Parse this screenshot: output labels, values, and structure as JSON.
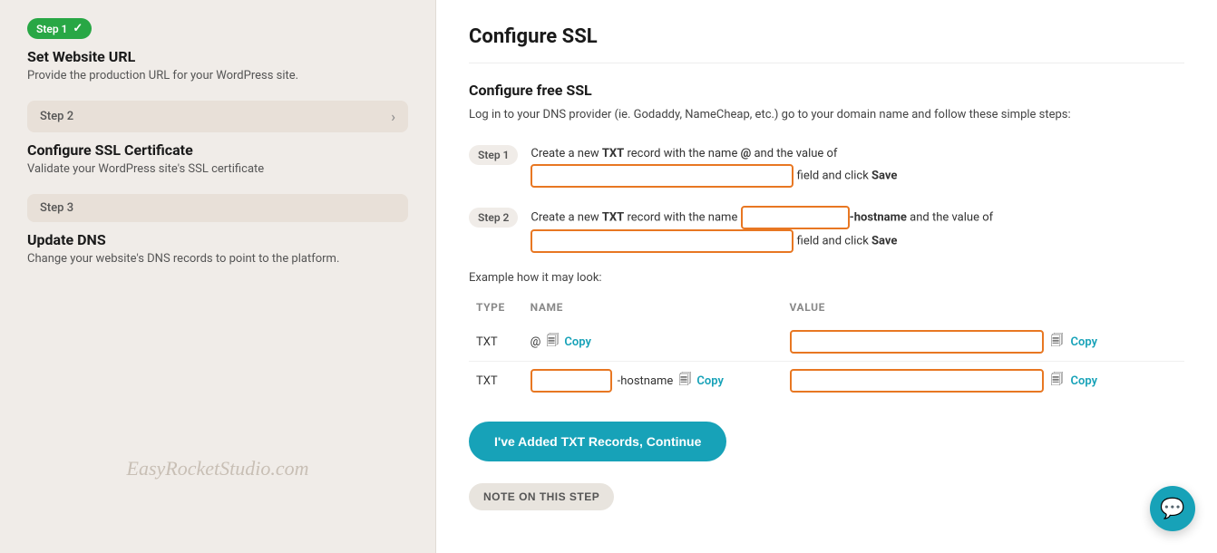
{
  "sidebar": {
    "step1": {
      "badge": "Step 1",
      "checkmark": "✓",
      "title": "Set Website URL",
      "description": "Provide the production URL for your WordPress site."
    },
    "step2": {
      "label": "Step 2",
      "chevron": "›"
    },
    "section2": {
      "title": "Configure SSL Certificate",
      "description": "Validate your WordPress site's SSL certificate"
    },
    "step3": {
      "label": "Step 3"
    },
    "section3": {
      "title": "Update DNS",
      "description": "Change your website's DNS records to point to the platform."
    },
    "watermark": "EasyRocketStudio.com"
  },
  "main": {
    "page_title": "Configure SSL",
    "section_title": "Configure free SSL",
    "intro_text": "Log in to your DNS provider (ie. Godaddy, NameCheap, etc.) go to your domain name and follow these simple steps:",
    "step1": {
      "badge": "Step 1",
      "text_before": "Create a new ",
      "bold1": "TXT",
      "text_mid1": " record with the name ",
      "at": "@",
      "text_mid2": " and the value of",
      "text_after": " field and click ",
      "save": "Save"
    },
    "step2": {
      "badge": "Step 2",
      "text_before": "Create a new ",
      "bold1": "TXT",
      "text_mid1": " record with the name ",
      "hostname_suffix": "-hostname",
      "text_mid2": " and the value of",
      "text_after": " field and click ",
      "save": "Save"
    },
    "example_label": "Example how it may look:",
    "table": {
      "headers": [
        "TYPE",
        "NAME",
        "VALUE"
      ],
      "rows": [
        {
          "type": "TXT",
          "name_prefix": "@",
          "name_copy": "Copy",
          "value_copy": "Copy"
        },
        {
          "type": "TXT",
          "name_prefix": "",
          "name_hostname": "-hostname",
          "name_copy": "Copy",
          "value_copy": "Copy"
        }
      ]
    },
    "continue_button": "I've Added TXT Records, Continue",
    "note_button": "NOTE ON THIS STEP"
  },
  "chat": {
    "icon": "💬"
  }
}
